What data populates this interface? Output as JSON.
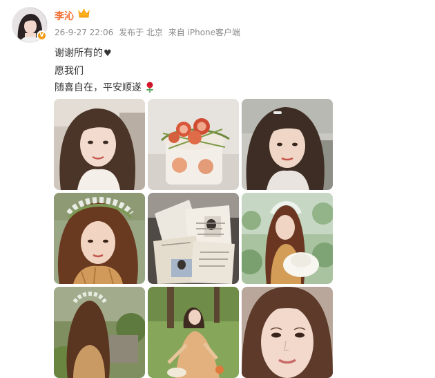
{
  "user": {
    "name": "李沁",
    "verified": "V",
    "badge_icon": "crown-icon"
  },
  "meta": {
    "time": "26-9-27 22:06",
    "location": "发布于 北京",
    "source": "来自 iPhone客户端"
  },
  "post": {
    "lines": [
      "谢谢所有的",
      "愿我们",
      "随喜自在，平安顺遂"
    ],
    "emoji": [
      "black-heart-icon",
      "rose-icon"
    ]
  },
  "photos": [
    {
      "name": "photo-selfie-car"
    },
    {
      "name": "photo-fig-cake"
    },
    {
      "name": "photo-selfie-curls"
    },
    {
      "name": "photo-flower-crown-portrait"
    },
    {
      "name": "photo-letters"
    },
    {
      "name": "photo-garden-hat"
    },
    {
      "name": "photo-garden-back"
    },
    {
      "name": "photo-lawn-picnic"
    },
    {
      "name": "photo-closeup-face"
    }
  ],
  "colors": {
    "name": "#f16c2c",
    "meta": "#8b8b8b",
    "text": "#333333",
    "verified_badge": "#f29b16"
  }
}
